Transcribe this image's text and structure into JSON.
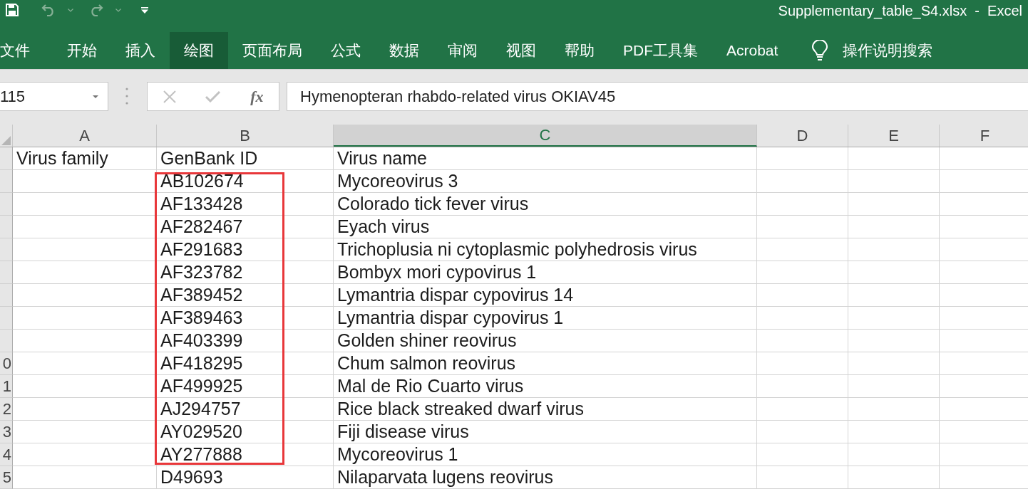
{
  "title_bar": {
    "quick_access": [
      {
        "kind": "save",
        "disabled": false
      },
      {
        "kind": "undo",
        "disabled": true
      },
      {
        "kind": "redo",
        "disabled": true
      },
      {
        "kind": "customize",
        "disabled": false
      }
    ],
    "title": "Supplementary_table_S4.xlsx  -  Excel"
  },
  "ribbon": {
    "tabs": [
      {
        "label": "文件",
        "selected": false
      },
      {
        "label": "开始",
        "selected": false
      },
      {
        "label": "插入",
        "selected": false
      },
      {
        "label": "绘图",
        "selected": true
      },
      {
        "label": "页面布局",
        "selected": false
      },
      {
        "label": "公式",
        "selected": false
      },
      {
        "label": "数据",
        "selected": false
      },
      {
        "label": "审阅",
        "selected": false
      },
      {
        "label": "视图",
        "selected": false
      },
      {
        "label": "帮助",
        "selected": false
      },
      {
        "label": "PDF工具集",
        "selected": false
      },
      {
        "label": "Acrobat",
        "selected": false
      }
    ],
    "tell_me": {
      "label": "操作说明搜索"
    }
  },
  "formula_bar": {
    "name_box": {
      "value": "115"
    },
    "buttons": [
      {
        "kind": "cancel",
        "disabled": true
      },
      {
        "kind": "enter",
        "disabled": true
      },
      {
        "kind": "function",
        "label": "fx",
        "disabled": false
      }
    ],
    "formula": {
      "value": "Hymenopteran rhabdo-related virus OKIAV45"
    }
  },
  "sheet": {
    "columns": [
      {
        "label": "A",
        "selected": false
      },
      {
        "label": "B",
        "selected": false
      },
      {
        "label": "C",
        "selected": true
      },
      {
        "label": "D",
        "selected": false
      },
      {
        "label": "E",
        "selected": false
      },
      {
        "label": "F",
        "selected": false
      }
    ],
    "annotation": {
      "kind": "rectangle"
    },
    "rows": [
      {
        "cell_a": "Virus family",
        "cell_b": "GenBank ID",
        "cell_c": "Virus name"
      },
      {
        "cell_b": "AB102674",
        "cell_c": "Mycoreovirus 3"
      },
      {
        "cell_b": "AF133428",
        "cell_c": "Colorado tick fever virus"
      },
      {
        "cell_b": "AF282467",
        "cell_c": "Eyach virus"
      },
      {
        "cell_b": "AF291683",
        "cell_c": "Trichoplusia ni cytoplasmic polyhedrosis virus"
      },
      {
        "cell_b": "AF323782",
        "cell_c": "Bombyx mori cypovirus 1"
      },
      {
        "cell_b": "AF389452",
        "cell_c": "Lymantria dispar cypovirus 14"
      },
      {
        "cell_b": "AF389463",
        "cell_c": "Lymantria dispar cypovirus 1"
      },
      {
        "cell_b": "AF403399",
        "cell_c": "Golden shiner reovirus"
      },
      {
        "number": "0",
        "cell_b": "AF418295",
        "cell_c": "Chum salmon reovirus"
      },
      {
        "number": "1",
        "cell_b": "AF499925",
        "cell_c": "Mal de Rio Cuarto virus"
      },
      {
        "number": "2",
        "cell_b": "AJ294757",
        "cell_c": "Rice black streaked dwarf virus"
      },
      {
        "number": "3",
        "cell_b": "AY029520",
        "cell_c": "Fiji disease virus"
      },
      {
        "number": "4",
        "cell_b": "AY277888",
        "cell_c": "Mycoreovirus 1"
      },
      {
        "number": "5",
        "cell_b": "D49693",
        "cell_c": "Nilaparvata lugens reovirus"
      }
    ]
  }
}
